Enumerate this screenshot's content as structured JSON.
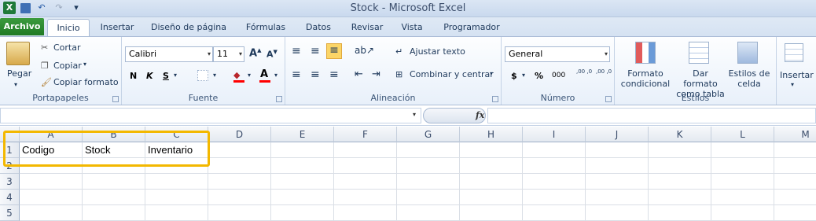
{
  "window": {
    "title": "Stock - Microsoft Excel"
  },
  "tabs": [
    "Archivo",
    "Inicio",
    "Insertar",
    "Diseño de página",
    "Fórmulas",
    "Datos",
    "Revisar",
    "Vista",
    "Programador"
  ],
  "ribbon": {
    "clipboard": {
      "paste": "Pegar",
      "cut": "Cortar",
      "copy": "Copiar",
      "format_painter": "Copiar formato",
      "label": "Portapapeles"
    },
    "font": {
      "name": "Calibri",
      "size": "11",
      "bold": "N",
      "italic": "K",
      "underline": "S",
      "label": "Fuente"
    },
    "alignment": {
      "wrap": "Ajustar texto",
      "merge": "Combinar y centrar",
      "label": "Alineación"
    },
    "number": {
      "format": "General",
      "currency": "$",
      "percent": "%",
      "thousands": "000",
      "inc_dec": ",00 ,0",
      "dec_dec": ",00 ,0",
      "label": "Número"
    },
    "styles": {
      "conditional": "Formato condicional",
      "table": "Dar formato como tabla",
      "cell_styles": "Estilos de celda",
      "label": "Estilos"
    },
    "cells": {
      "insert": "Insertar"
    }
  },
  "formula_bar": {
    "fx": "fx",
    "value": ""
  },
  "sheet": {
    "columns": [
      "A",
      "B",
      "C",
      "D",
      "E",
      "F",
      "G",
      "H",
      "I",
      "J",
      "K",
      "L",
      "M"
    ],
    "rows": [
      "1",
      "2",
      "3",
      "4",
      "5"
    ],
    "cells": {
      "A1": "Codigo",
      "B1": "Stock",
      "C1": "Inventario"
    }
  }
}
